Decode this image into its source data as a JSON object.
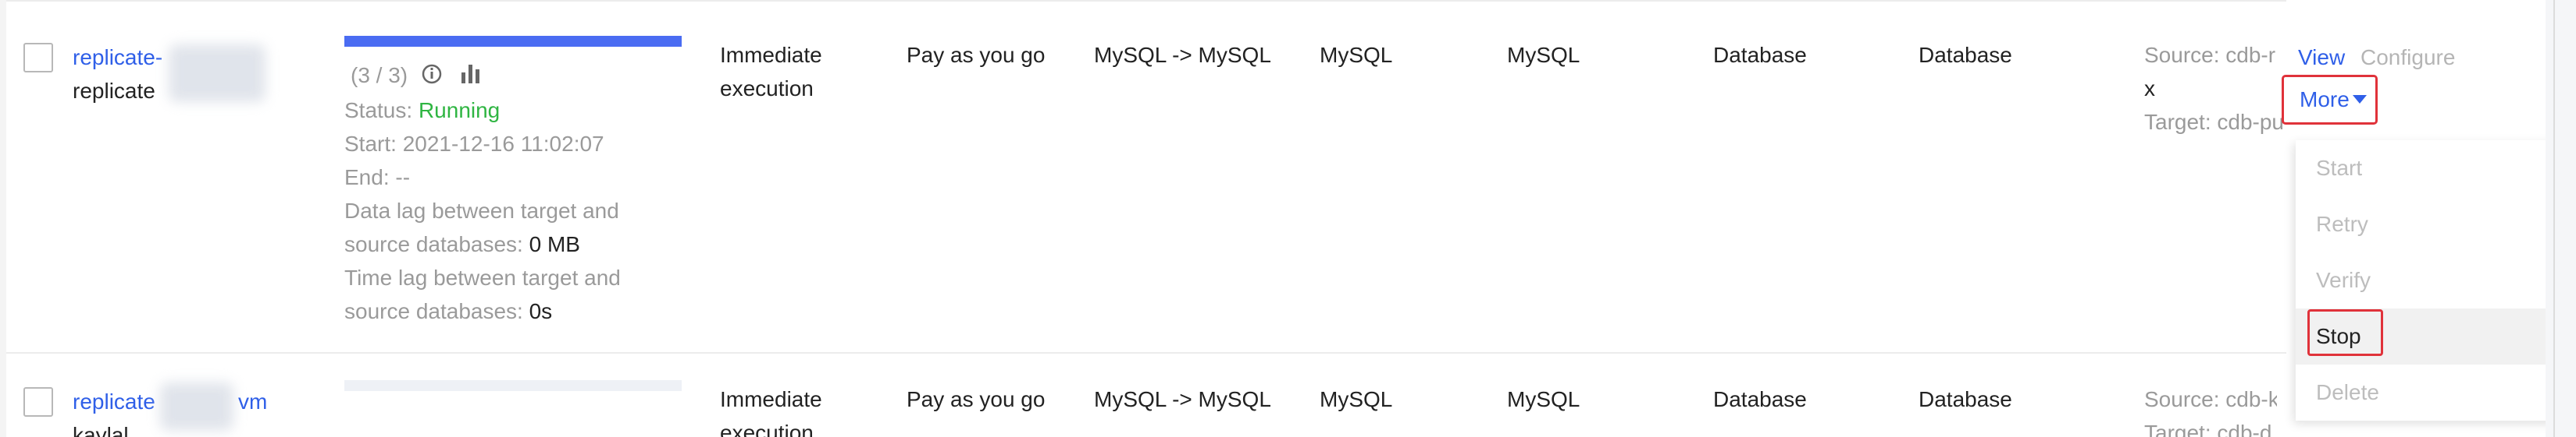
{
  "rows": [
    {
      "name_prefix": "replicate-",
      "subtitle_prefix": "replicate",
      "progress_count": "(3 / 3)",
      "progress_fraction": 1,
      "status_label": "Status:",
      "status_value": "Running",
      "start_label": "Start:",
      "start_value": "2021-12-16 11:02:07",
      "end_label": "End:",
      "end_value": "--",
      "data_lag_line1": "Data lag between target and",
      "data_lag_line2_label": "source databases:",
      "data_lag_value": "0 MB",
      "time_lag_line1": "Time lag between target and",
      "time_lag_line2_label": "source databases:",
      "time_lag_value": "0s",
      "execution_line1": "Immediate",
      "execution_line2": "execution",
      "billing": "Pay as you go",
      "direction": "MySQL -> MySQL",
      "source_type": "MySQL",
      "target_type": "MySQL",
      "source_kind": "Database",
      "target_kind": "Database",
      "source_prefix": "Source: cdb-r",
      "source_suffix": "x",
      "target_prefix": "Target: cdb-pu",
      "actions": {
        "view": "View",
        "configure": "Configure",
        "more": "More"
      }
    },
    {
      "name_prefix": "replicate",
      "name_suffix": "vm",
      "subtitle_prefix": "kaylal",
      "progress_fraction": 0,
      "execution_line1": "Immediate",
      "execution_line2": "execution",
      "billing": "Pay as you go",
      "direction": "MySQL -> MySQL",
      "source_type": "MySQL",
      "target_type": "MySQL",
      "source_kind": "Database",
      "target_kind": "Database",
      "source_prefix": "Source: cdb-k",
      "target_prefix": "Target: cdb-d"
    }
  ],
  "dropdown": {
    "items": [
      "Start",
      "Retry",
      "Verify",
      "Stop",
      "Delete"
    ]
  }
}
